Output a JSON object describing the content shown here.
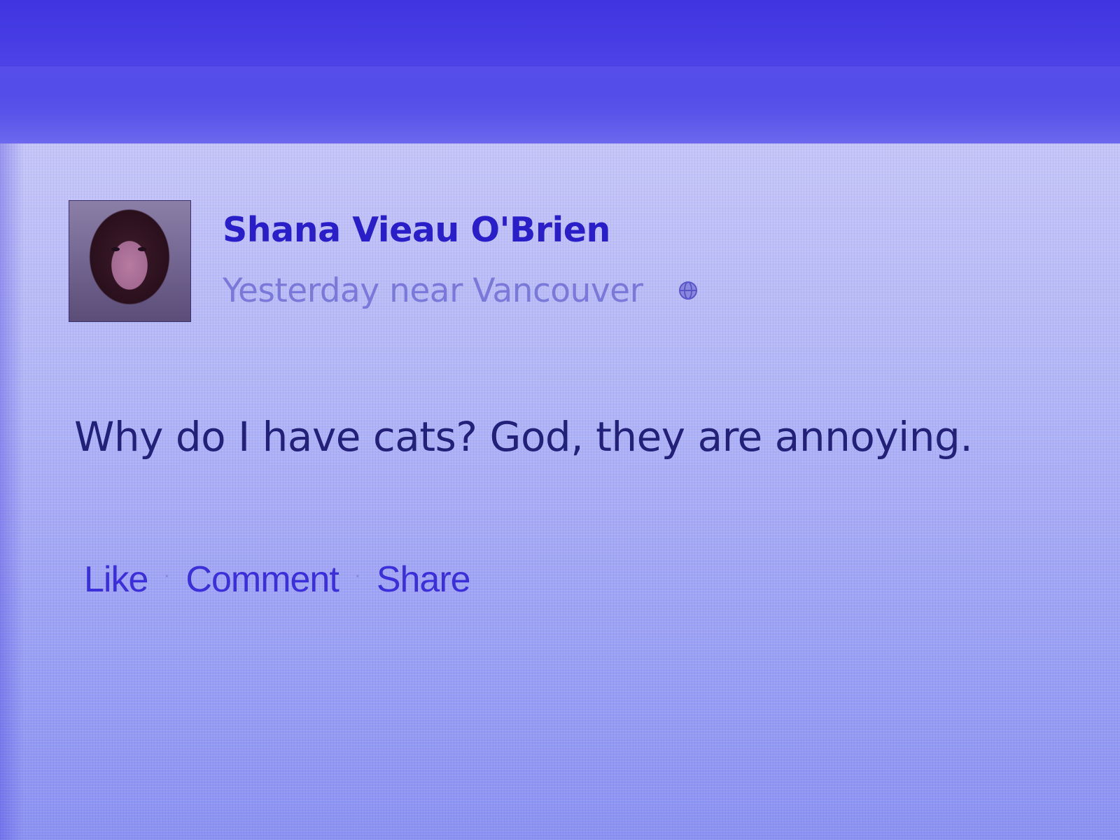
{
  "post": {
    "author": "Shana Vieau O'Brien",
    "meta": "Yesterday near Vancouver",
    "privacy_icon": "globe-icon",
    "message": "Why do I have cats? God, they are annoying.",
    "actions": {
      "like": "Like",
      "comment": "Comment",
      "share": "Share",
      "separator": "·"
    }
  },
  "colors": {
    "background": "#5b52ee",
    "post_area": "#b3b6f6",
    "author_name": "#2a1ec9",
    "meta_text": "#7a78d8",
    "message_text": "#232078",
    "action_link": "#3a2fd8"
  }
}
